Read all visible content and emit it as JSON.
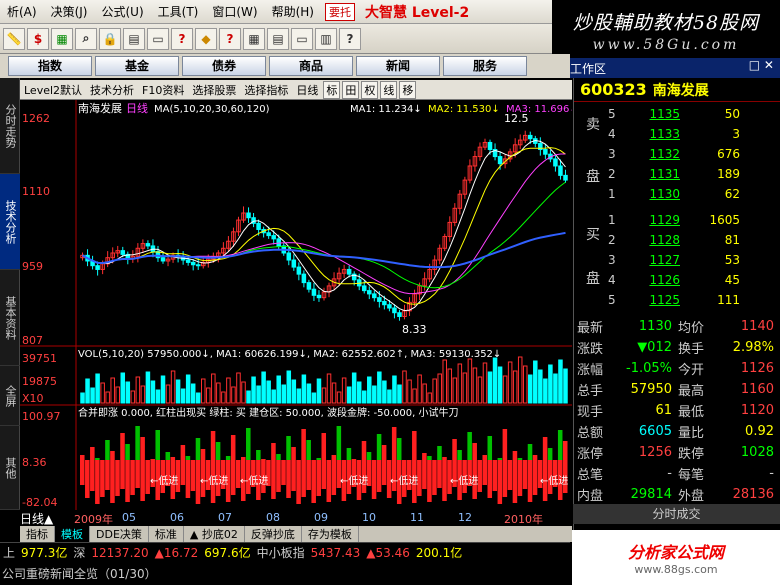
{
  "menu": [
    "析(A)",
    "决策(J)",
    "公式(U)",
    "工具(T)",
    "窗口(W)",
    "帮助(H)"
  ],
  "menu_title": "要托",
  "brand": "大智慧 Level-2",
  "watermark": {
    "line1": "炒股輔助教材58股网",
    "line2": "www.58Gu.com"
  },
  "nav": [
    "指数",
    "基金",
    "债券",
    "商品",
    "新闻",
    "服务"
  ],
  "workarea": {
    "label": "工作区",
    "controls": "□ ✕"
  },
  "left_tabs": [
    {
      "label": "分时走势",
      "active": false
    },
    {
      "label": "技术分析",
      "active": true
    },
    {
      "label": "基本资料",
      "active": false
    },
    {
      "label": "全屏",
      "active": false
    },
    {
      "label": "其他",
      "active": false
    }
  ],
  "chart_header": {
    "level": "Level2默认",
    "tech": "技术分析",
    "f10": "F10资料",
    "pick": "选择股票",
    "indicator": "选择指标",
    "period": "日线",
    "icons": [
      "标",
      "田",
      "权",
      "线",
      "移"
    ]
  },
  "stock": {
    "code": "600323",
    "name": "南海发展"
  },
  "sell": [
    {
      "lvl": "5",
      "price": "1135",
      "vol": "50"
    },
    {
      "lvl": "4",
      "price": "1133",
      "vol": "3"
    },
    {
      "lvl": "3",
      "price": "1132",
      "vol": "676"
    },
    {
      "lvl": "2",
      "price": "1131",
      "vol": "189"
    },
    {
      "lvl": "1",
      "price": "1130",
      "vol": "62"
    }
  ],
  "sell_label": [
    "卖",
    "盘"
  ],
  "buy": [
    {
      "lvl": "1",
      "price": "1129",
      "vol": "1605"
    },
    {
      "lvl": "2",
      "price": "1128",
      "vol": "81"
    },
    {
      "lvl": "3",
      "price": "1127",
      "vol": "53"
    },
    {
      "lvl": "4",
      "price": "1126",
      "vol": "45"
    },
    {
      "lvl": "5",
      "price": "1125",
      "vol": "111"
    }
  ],
  "buy_label": [
    "买",
    "盘"
  ],
  "stats": [
    {
      "l": "最新",
      "v": "1130",
      "vc": "#00ff00",
      "r": "均价",
      "v2": "1140",
      "v2c": "#ff4040"
    },
    {
      "l": "涨跌",
      "v": "▼012",
      "vc": "#00ff00",
      "r": "换手",
      "v2": "2.98%",
      "v2c": "#ffff00"
    },
    {
      "l": "涨幅",
      "v": "-1.05%",
      "vc": "#00ff00",
      "r": "今开",
      "v2": "1126",
      "v2c": "#ff4040"
    },
    {
      "l": "总手",
      "v": "57950",
      "vc": "#ffff00",
      "r": "最高",
      "v2": "1160",
      "v2c": "#ff4040"
    },
    {
      "l": "现手",
      "v": "61",
      "vc": "#ffff00",
      "r": "最低",
      "v2": "1120",
      "v2c": "#ff4040"
    },
    {
      "l": "总额",
      "v": "6605",
      "vc": "#00ffff",
      "r": "量比",
      "v2": "0.92",
      "v2c": "#ffff00"
    },
    {
      "l": "涨停",
      "v": "1256",
      "vc": "#ff4040",
      "r": "跌停",
      "v2": "1028",
      "v2c": "#00ff00"
    },
    {
      "l": "总笔",
      "v": "-",
      "vc": "#ccc",
      "r": "每笔",
      "v2": "-",
      "v2c": "#ccc"
    },
    {
      "l": "内盘",
      "v": "29814",
      "vc": "#00ff00",
      "r": "外盘",
      "v2": "28136",
      "v2c": "#ff4040"
    }
  ],
  "fenbi": "分时成交",
  "bottom_tabs": [
    {
      "label": "指标",
      "on": false
    },
    {
      "label": "模板",
      "on": true
    },
    {
      "label": "DDE决策",
      "on": false
    },
    {
      "label": "标准",
      "on": false
    },
    {
      "label": "▲ 抄底02",
      "on": false
    },
    {
      "label": "反弹抄底",
      "on": false
    },
    {
      "label": "存为模板",
      "on": false
    }
  ],
  "ticker": [
    {
      "t": "上",
      "c": "#ccc"
    },
    {
      "t": "977.3亿",
      "c": "#ffff00"
    },
    {
      "t": "深",
      "c": "#ccc"
    },
    {
      "t": "12137.20",
      "c": "#ff4040"
    },
    {
      "t": "▲16.72",
      "c": "#ff4040"
    },
    {
      "t": "697.6亿",
      "c": "#ffff00"
    },
    {
      "t": "中小板指",
      "c": "#ccc"
    },
    {
      "t": "5437.43",
      "c": "#ff4040"
    },
    {
      "t": "▲53.46",
      "c": "#ff4040"
    },
    {
      "t": "200.1亿",
      "c": "#ffff00"
    }
  ],
  "news": "公司重磅新闻全览（01/30）",
  "logo": {
    "l1": "分析家公式网",
    "l2": "www.88gs.com"
  },
  "day": "日线▲",
  "chart_data": {
    "type": "candlestick",
    "title": "南海发展",
    "period": "日线",
    "ma_line": "MA(5,10,20,30,60,120)",
    "ma_values": [
      {
        "name": "MA1",
        "value": "11.234"
      },
      {
        "name": "MA2",
        "value": "11.530"
      },
      {
        "name": "MA3",
        "value": "11.696"
      },
      {
        "name": "MA4",
        "value": "1"
      }
    ],
    "price_ticks": [
      "1262",
      "1110",
      "959",
      "807"
    ],
    "ylim": [
      807,
      1262
    ],
    "low_annotation": "8.33",
    "high_annotation": "12.5",
    "vol_header": "VOL(5,10,20)  57950.000↓, MA1: 60626.199↓, MA2: 62552.602↑, MA3: 59130.352↓",
    "vol_ticks": [
      "39751",
      "19875",
      "X10"
    ],
    "osc_header": "合并即涨 0.000, 红柱出现买  绿柱: 买  建仓区: 50.000, 波段金牌: -50.000, 小试牛刀",
    "osc_ticks": [
      "100.97",
      "8.36",
      "-82.04"
    ],
    "signal_labels": [
      "←低进",
      "←低进",
      "←低进",
      "←低进",
      "←低进",
      "←低进",
      "←低进"
    ],
    "x_labels": [
      "2009年",
      "05",
      "06",
      "07",
      "08",
      "09",
      "10",
      "11",
      "12",
      "2010年"
    ],
    "close": [
      970,
      958,
      948,
      940,
      952,
      965,
      975,
      980,
      972,
      962,
      968,
      985,
      995,
      990,
      978,
      965,
      958,
      962,
      970,
      968,
      960,
      955,
      950,
      948,
      955,
      962,
      968,
      975,
      985,
      1000,
      1020,
      1045,
      1060,
      1050,
      1038,
      1025,
      1018,
      1012,
      1005,
      990,
      975,
      960,
      945,
      930,
      912,
      898,
      885,
      880,
      892,
      905,
      920,
      932,
      940,
      930,
      918,
      905,
      895,
      888,
      880,
      872,
      865,
      858,
      848,
      840,
      852,
      870,
      888,
      905,
      920,
      940,
      960,
      985,
      1010,
      1040,
      1070,
      1100,
      1130,
      1160,
      1180,
      1200,
      1210,
      1195,
      1180,
      1165,
      1175,
      1190,
      1205,
      1215,
      1225,
      1218,
      1208,
      1195,
      1185,
      1175,
      1160,
      1140,
      1130
    ]
  }
}
